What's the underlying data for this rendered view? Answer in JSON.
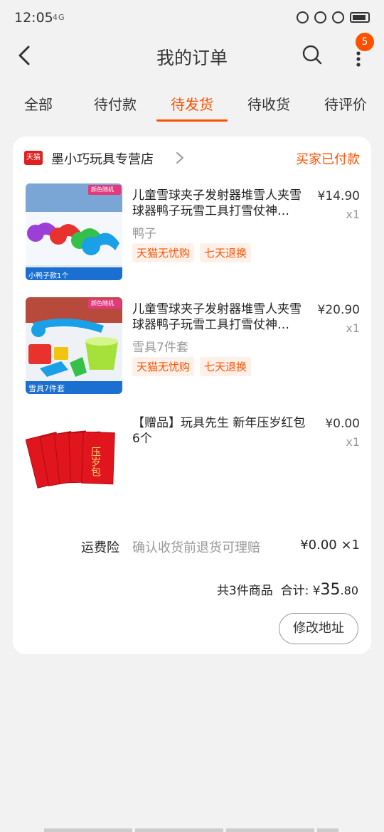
{
  "status_bar": {
    "time": "12:05",
    "signal": "4G"
  },
  "header": {
    "title": "我的订单",
    "badge_count": "5"
  },
  "tabs": [
    {
      "label": "全部"
    },
    {
      "label": "待付款"
    },
    {
      "label": "待发货",
      "active": true
    },
    {
      "label": "待收货"
    },
    {
      "label": "待评价"
    }
  ],
  "order": {
    "shop_badge": "天猫",
    "shop_name": "墨小巧玩具专营店",
    "status": "买家已付款",
    "items": [
      {
        "title": "儿童雪球夹子发射器堆雪人夹雪球器鸭子玩雪工具打雪仗神…",
        "sku": "鸭子",
        "price": "¥14.90",
        "qty": "x1",
        "tags": [
          "天猫无忧购",
          "七天退换"
        ],
        "thumb_text": "小鸭子款1个",
        "thumb_corner": "颜色随机"
      },
      {
        "title": "儿童雪球夹子发射器堆雪人夹雪球器鸭子玩雪工具打雪仗神…",
        "sku": "雪具7件套",
        "price": "¥20.90",
        "qty": "x1",
        "tags": [
          "天猫无忧购",
          "七天退换"
        ],
        "thumb_text": "雪具7件套",
        "thumb_corner": "颜色随机"
      },
      {
        "title": "【赠品】玩具先生 新年压岁红包6个",
        "sku": "",
        "price": "¥0.00",
        "qty": "x1",
        "tags": [],
        "thumb_text": "压岁包"
      }
    ],
    "insurance": {
      "label": "运费险",
      "desc": "确认收货前退货可理赔",
      "value": "¥0.00 ×1"
    },
    "summary": {
      "count_text": "共3件商品",
      "total_label": "合计:",
      "currency": "¥",
      "integer": "35",
      "decimal": ".80"
    },
    "action_button": "修改地址"
  },
  "colors": {
    "accent": "#ff5000",
    "background": "#f2f2f2"
  }
}
